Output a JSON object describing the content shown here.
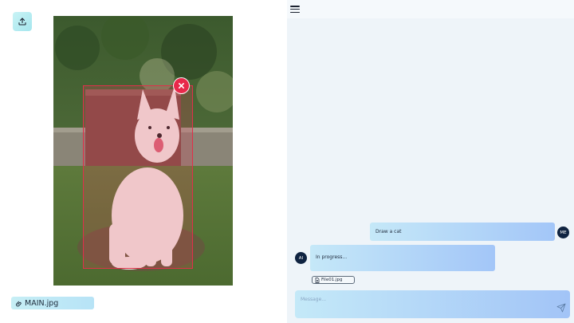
{
  "left_pane": {
    "file_chip_label": "MAIN.jpg"
  },
  "chat": {
    "messages": [
      {
        "sender": "me",
        "avatar_label": "ME",
        "text": "Draw a cat"
      },
      {
        "sender": "ai",
        "avatar_label": "AI",
        "text": "In progress..."
      }
    ],
    "attachment_label": "File01.jpg",
    "composer_placeholder": "Message..."
  },
  "colors": {
    "selection_border": "#e0304a",
    "remove_button": "#e8294b",
    "avatar_bg": "#0f2341",
    "bubble_gradient_start": "#c5e8f8",
    "bubble_gradient_end": "#a3c6f8",
    "right_pane_bg": "#eef4f9"
  },
  "icons": {
    "upload": "upload-icon",
    "remove": "close-icon",
    "file_chip": "paperclip-icon",
    "menu": "hamburger-menu-icon",
    "attachment": "document-icon",
    "send": "send-icon"
  }
}
